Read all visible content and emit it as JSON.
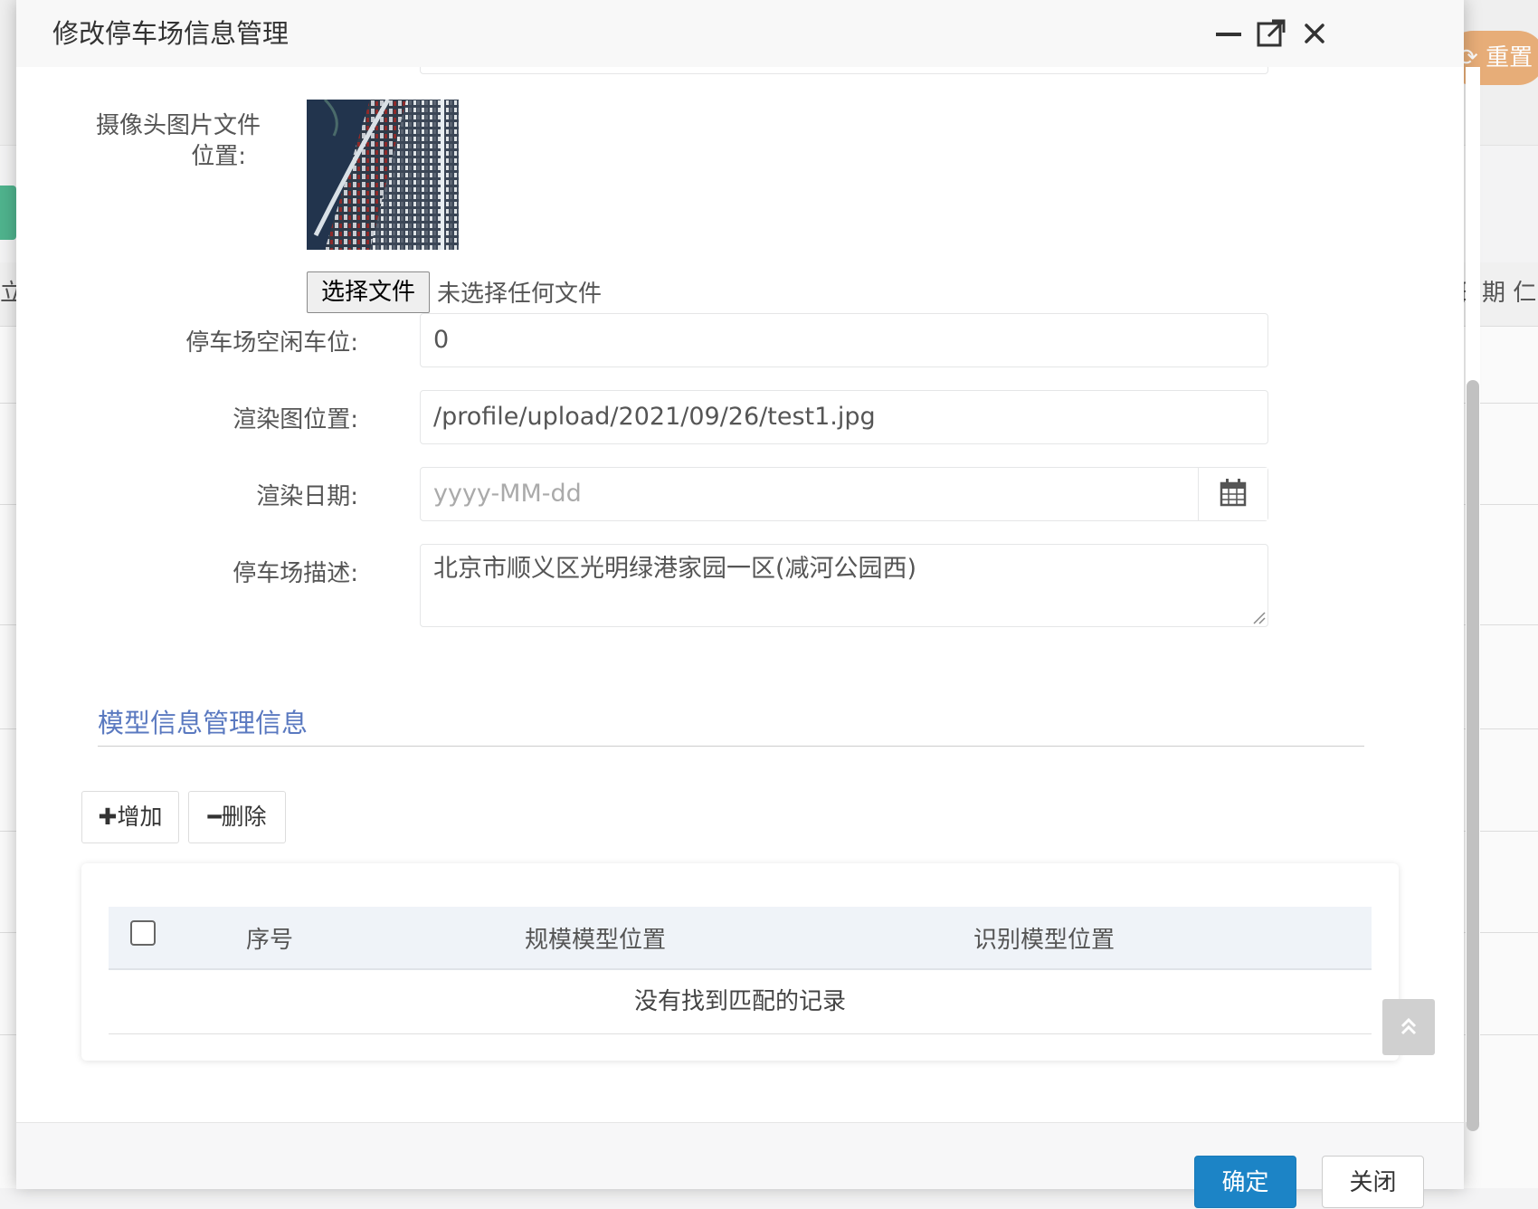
{
  "background": {
    "reset_button": "重置",
    "left_header_fragment": "立",
    "right_header_fragment": "日期  仁"
  },
  "dialog": {
    "title": "修改停车场信息管理",
    "form": {
      "camera_image_label_line1": "摄像头图片文件",
      "camera_image_label_line2": "位置:",
      "file_button": "选择文件",
      "file_status": "未选择任何文件",
      "free_spaces_label": "停车场空闲车位:",
      "free_spaces_value": "0",
      "render_image_label": "渲染图位置:",
      "render_image_value": "/profile/upload/2021/09/26/test1.jpg",
      "render_date_label": "渲染日期:",
      "render_date_placeholder": "yyyy-MM-dd",
      "description_label": "停车场描述:",
      "description_value": "北京市顺义区光明绿港家园一区(减河公园西)"
    },
    "section_title": "模型信息管理信息",
    "toolbar": {
      "add_label": "增加",
      "delete_label": "删除"
    },
    "table": {
      "columns": [
        "序号",
        "规模模型位置",
        "识别模型位置"
      ],
      "empty_text": "没有找到匹配的记录"
    },
    "footer": {
      "ok_label": "确定",
      "close_label": "关闭"
    }
  },
  "colors": {
    "primary": "#1c84c6",
    "section_title": "#5a79c0",
    "reset_button": "#e6a264"
  }
}
